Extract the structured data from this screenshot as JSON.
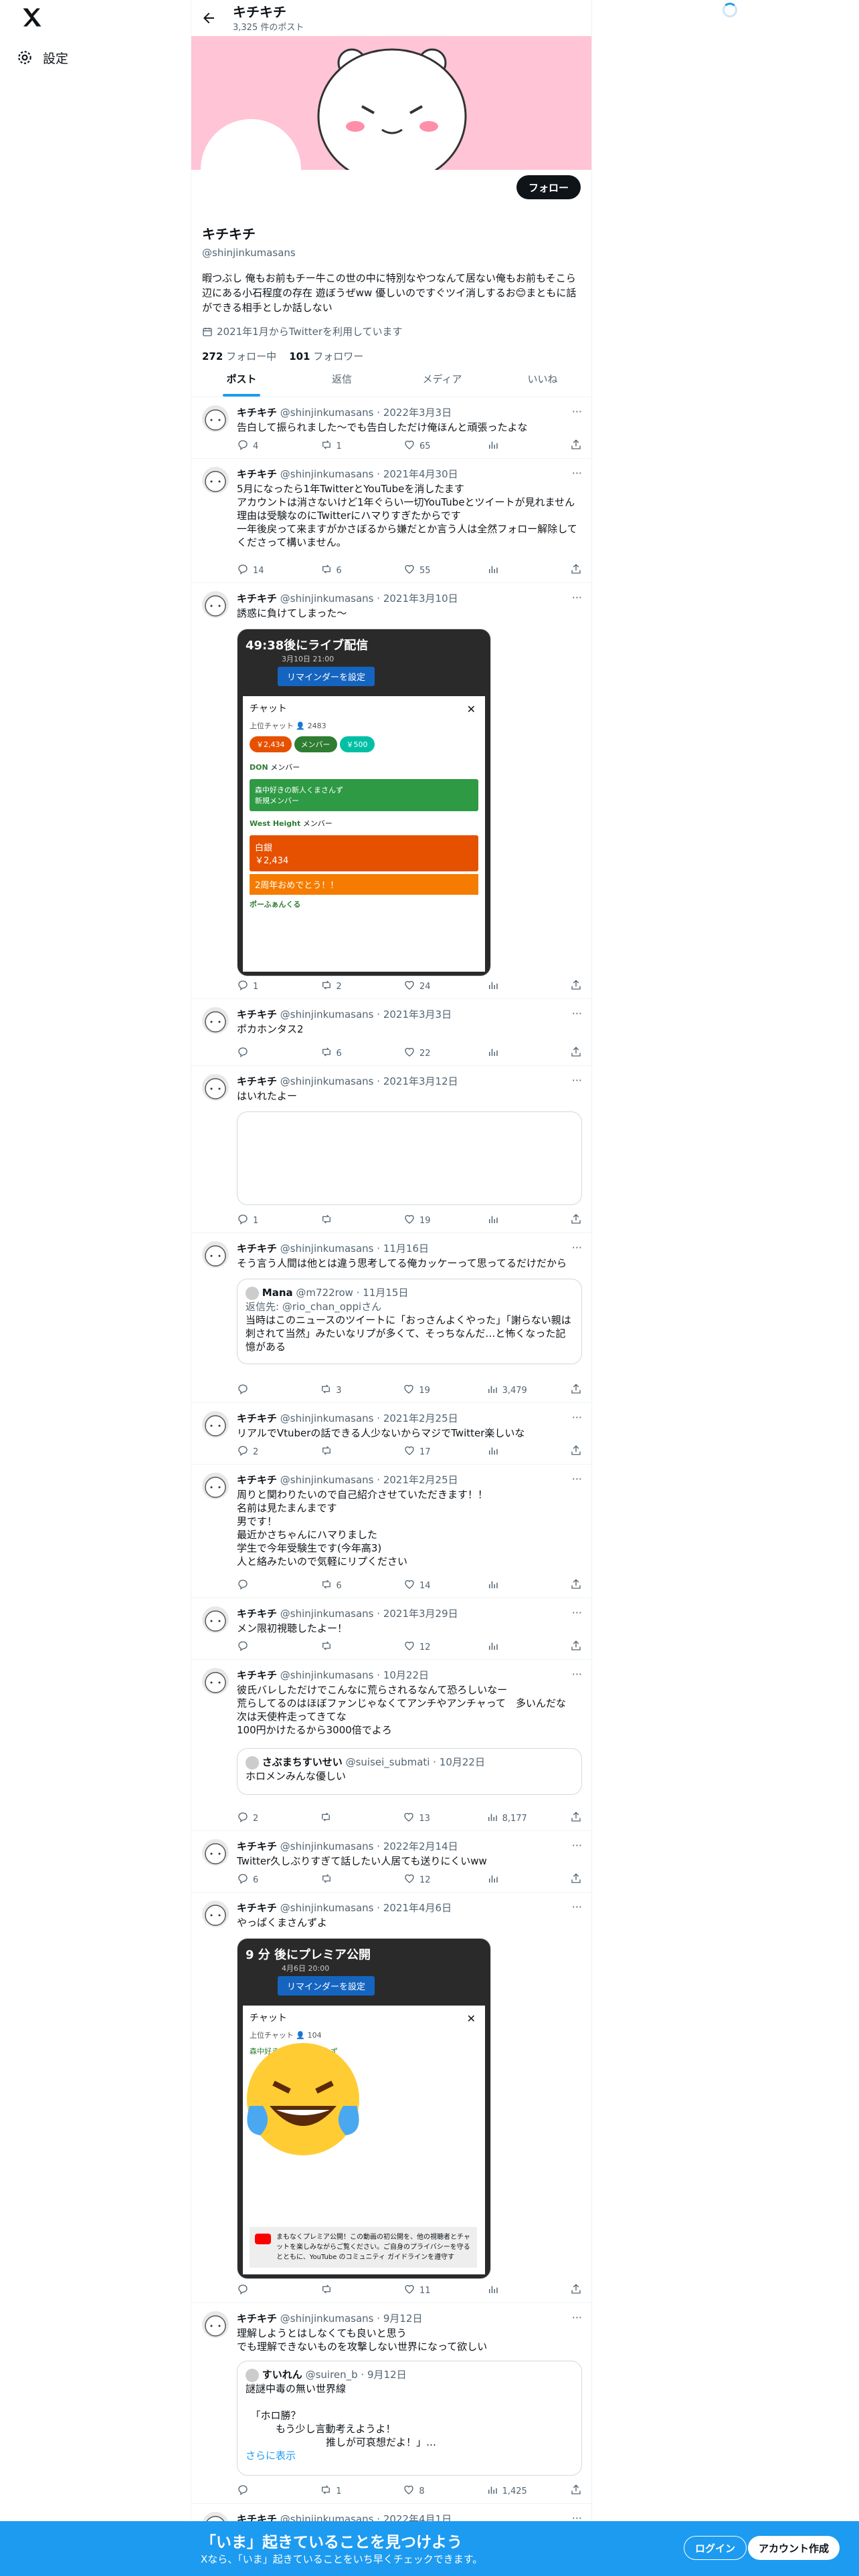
{
  "nav": {
    "settings_label": "設定"
  },
  "header": {
    "name": "キチキチ",
    "posts_count": "3,325 件のポスト"
  },
  "profile": {
    "name": "キチキチ",
    "handle": "@shinjinkumasans",
    "bio": "暇つぶし 俺もお前もチー牛この世の中に特別なやつなんて居ない俺もお前もそこら辺にある小石程度の存在 遊ぼうぜww 優しいのですぐツイ消しするお😊まともに話ができる相手としか話しない",
    "joined": "2021年1月からTwitterを利用しています",
    "following_count": "272",
    "following_label": "フォロー中",
    "followers_count": "101",
    "followers_label": "フォロワー",
    "follow_button": "フォロー"
  },
  "tabs": [
    {
      "label": "ポスト",
      "active": true
    },
    {
      "label": "返信",
      "active": false
    },
    {
      "label": "メディア",
      "active": false
    },
    {
      "label": "いいね",
      "active": false
    }
  ],
  "tweets": [
    {
      "name": "キチキチ",
      "handle": "@shinjinkumasans",
      "date": "2022年3月3日",
      "text": "告白して振られました〜でも告白しただけ俺ほんと頑張ったよな",
      "replies": "4",
      "retweets": "1",
      "likes": "65",
      "views": ""
    },
    {
      "name": "キチキチ",
      "handle": "@shinjinkumasans",
      "date": "2021年4月30日",
      "text": "5月になったら1年TwitterとYouTubeを消したます\nアカウントは消さないけど1年ぐらい一切YouTubeとツイートが見れません\n理由は受験なのにTwitterにハマりすぎたからです\n一年後戻って来ますがかさぼるから嫌だとか言う人は全然フォロー解除してくださって構いません。",
      "replies": "14",
      "retweets": "6",
      "likes": "55",
      "views": ""
    },
    {
      "name": "キチキチ",
      "handle": "@shinjinkumasans",
      "date": "2021年3月10日",
      "text": "誘惑に負けてしまった〜",
      "replies": "1",
      "retweets": "2",
      "likes": "24",
      "views": "",
      "media": {
        "countdown": "49:38後にライブ配信",
        "date": "3月10日 21:00",
        "reminder": "リマインダーを設定",
        "chat": "チャット",
        "top_chat": "上位チャット",
        "viewers": "2483",
        "pills": [
          "￥2,434",
          "メンバー",
          "￥500"
        ],
        "msg1_name": "DON",
        "msg1_tag": "メンバー",
        "msg2_title": "森中好きの新人くまさんず",
        "msg2_sub": "新規メンバー",
        "msg3_name": "West Height",
        "msg3_tag": "メンバー",
        "sc_label": "白銀",
        "sc_amount": "￥2,434",
        "sc_msg": "2周年おめでとう！！",
        "msg4_name": "ポーふぁんくる"
      }
    },
    {
      "name": "キチキチ",
      "handle": "@shinjinkumasans",
      "date": "2021年3月3日",
      "text": "ポカホンタス2",
      "replies": "",
      "retweets": "6",
      "likes": "22",
      "views": ""
    },
    {
      "name": "キチキチ",
      "handle": "@shinjinkumasans",
      "date": "2021年3月12日",
      "text": "はいれたよー",
      "replies": "1",
      "retweets": "",
      "likes": "19",
      "views": ""
    },
    {
      "name": "キチキチ",
      "handle": "@shinjinkumasans",
      "date": "11月16日",
      "text": "そう言う人間は他とは違う思考してる俺カッケーって思ってるだけだから",
      "replies": "",
      "retweets": "3",
      "likes": "19",
      "views": "3,479",
      "quote": {
        "name": "Mana",
        "handle": "@m722row",
        "date": "11月15日",
        "reply_to": "返信先: @rio_chan_oppiさん",
        "text": "当時はこのニュースのツイートに「おっさんよくやった」「謝らない親は刺されて当然」みたいなリプが多くて、そっちなんだ…と怖くなった記憶がある"
      }
    },
    {
      "name": "キチキチ",
      "handle": "@shinjinkumasans",
      "date": "2021年2月25日",
      "text": "リアルでVtuberの話できる人少ないからマジでTwitter楽しいな",
      "replies": "2",
      "retweets": "",
      "likes": "17",
      "views": ""
    },
    {
      "name": "キチキチ",
      "handle": "@shinjinkumasans",
      "date": "2021年2月25日",
      "text": "周りと関わりたいので自己紹介させていただきます！！\n名前は見たまんまです\n男です！\n最近かさちゃんにハマりました\n学生で今年受験生です(今年高3)\n人と絡みたいので気軽にリプください",
      "replies": "",
      "retweets": "6",
      "likes": "14",
      "views": ""
    },
    {
      "name": "キチキチ",
      "handle": "@shinjinkumasans",
      "date": "2021年3月29日",
      "text": "メン限初視聴したよー！",
      "replies": "",
      "retweets": "",
      "likes": "12",
      "views": ""
    },
    {
      "name": "キチキチ",
      "handle": "@shinjinkumasans",
      "date": "10月22日",
      "text": "彼氏バレしただけでこんなに荒らされるなんて恐ろしいなー\n荒らしてるのはほぼファンじゃなくてアンチやアンチャって　多いんだな\n次は天使杵走ってきてな\n100円かけたるから3000倍でよろ",
      "replies": "2",
      "retweets": "",
      "likes": "13",
      "views": "8,177",
      "quote": {
        "name": "さぶまちすいせい",
        "handle": "@suisei_submati",
        "date": "10月22日",
        "reply_to": "",
        "text": "ホロメンみんな優しい"
      }
    },
    {
      "name": "キチキチ",
      "handle": "@shinjinkumasans",
      "date": "2022年2月14日",
      "text": "Twitter久しぶりすぎて話したい人居ても送りにくいww",
      "replies": "6",
      "retweets": "",
      "likes": "12",
      "views": ""
    },
    {
      "name": "キチキチ",
      "handle": "@shinjinkumasans",
      "date": "2021年4月6日",
      "text": "やっぱくまさんずよ",
      "replies": "",
      "retweets": "",
      "likes": "11",
      "views": "",
      "media": {
        "countdown": "9 分 後にプレミア公開",
        "date": "4月6日 20:00",
        "reminder": "リマインダーを設定",
        "chat": "チャット",
        "top_chat": "上位チャット",
        "viewers": "104",
        "msg2_title": "森中好きの新人くまさんず",
        "notice": "まもなくプレミア公開！この動画の初公開を、他の視聴者とチャットを楽しみながらご覧ください。ご自身のプライバシーを守るとともに、YouTube のコミュニティ ガイドラインを遵守す"
      }
    },
    {
      "name": "キチキチ",
      "handle": "@shinjinkumasans",
      "date": "9月12日",
      "text": "理解しようとはしなくても良いと思う\nでも理解できないものを攻撃しない世界になって欲しい",
      "replies": "",
      "retweets": "1",
      "likes": "8",
      "views": "1,425",
      "quote": {
        "name": "すいれん",
        "handle": "@suiren_b",
        "date": "9月12日",
        "reply_to": "",
        "text": "謎謎中毒の無い世界線\n\n　「ホロ勝？\n　　　もう少し言動考えようよ！\n　　　　　　　　推しが可哀想だよ！」…",
        "more": "さらに表示"
      }
    },
    {
      "name": "キチキチ",
      "handle": "@shinjinkumasans",
      "date": "2022年4月1日",
      "text": "",
      "replies": "",
      "retweets": "",
      "likes": "",
      "views": ""
    }
  ],
  "bottom_bar": {
    "title": "「いま」起きていることを見つけよう",
    "subtitle": "Xなら、「いま」起きていることをいち早くチェックできます。",
    "login": "ログイン",
    "signup": "アカウント作成"
  }
}
